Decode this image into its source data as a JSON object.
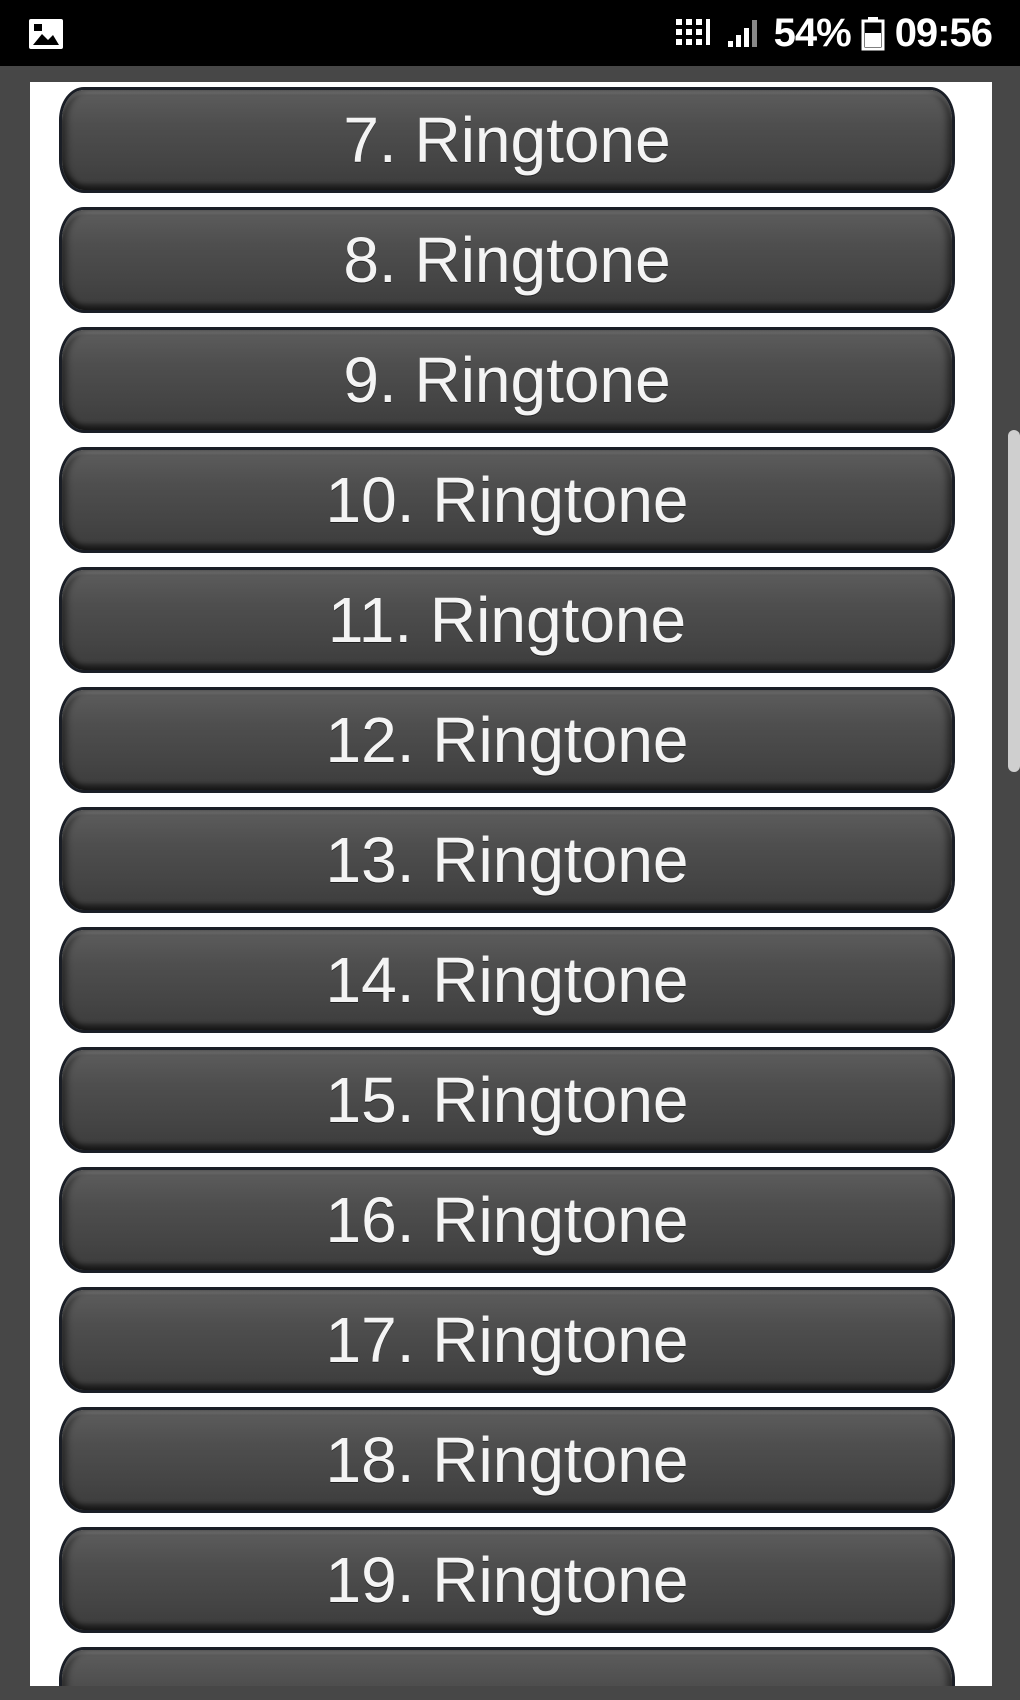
{
  "status_bar": {
    "battery": "54%",
    "time": "09:56",
    "icons": [
      "gallery-icon",
      "data-icon",
      "signal-icon",
      "battery-icon"
    ]
  },
  "list": {
    "items": [
      {
        "label": "7. Ringtone"
      },
      {
        "label": "8. Ringtone"
      },
      {
        "label": "9. Ringtone"
      },
      {
        "label": "10. Ringtone"
      },
      {
        "label": "11. Ringtone"
      },
      {
        "label": "12. Ringtone"
      },
      {
        "label": "13. Ringtone"
      },
      {
        "label": "14. Ringtone"
      },
      {
        "label": "15. Ringtone"
      },
      {
        "label": "16. Ringtone"
      },
      {
        "label": "17. Ringtone"
      },
      {
        "label": "18. Ringtone"
      },
      {
        "label": "19. Ringtone"
      }
    ]
  },
  "colors": {
    "background": "#474747",
    "panel": "#ffffff",
    "button": "#4e4e4e",
    "button_text": "#f4f4f4",
    "status_bar": "#000000"
  }
}
